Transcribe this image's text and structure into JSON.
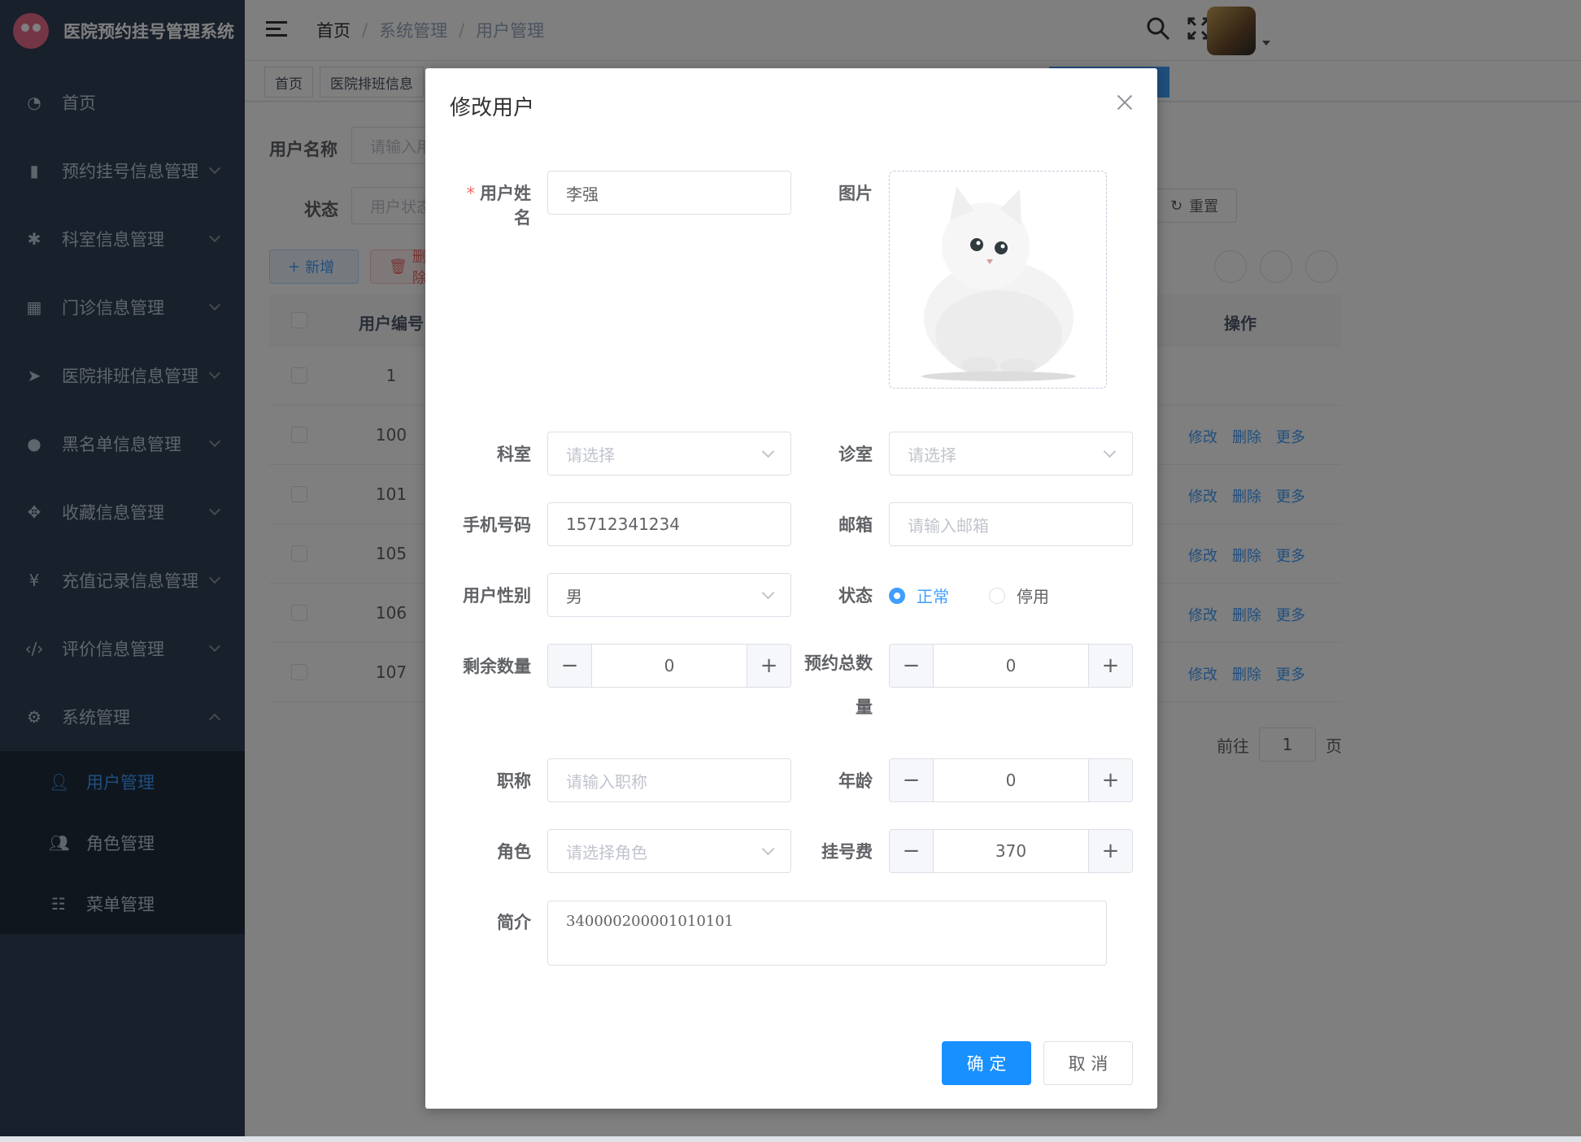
{
  "app": {
    "title": "医院预约挂号管理系统"
  },
  "sidebar": {
    "items": [
      {
        "label": "首页",
        "icon": "dashboard-icon"
      },
      {
        "label": "预约挂号信息管理",
        "icon": "bar-chart-icon"
      },
      {
        "label": "科室信息管理",
        "icon": "bug-icon"
      },
      {
        "label": "门诊信息管理",
        "icon": "table-icon"
      },
      {
        "label": "医院排班信息管理",
        "icon": "send-icon"
      },
      {
        "label": "黑名单信息管理",
        "icon": "globe-icon"
      },
      {
        "label": "收藏信息管理",
        "icon": "move-icon"
      },
      {
        "label": "充值记录信息管理",
        "icon": "yen-icon"
      },
      {
        "label": "评价信息管理",
        "icon": "code-icon"
      },
      {
        "label": "系统管理",
        "icon": "gear-icon"
      }
    ],
    "subitems": [
      {
        "label": "用户管理",
        "icon": "user-icon"
      },
      {
        "label": "角色管理",
        "icon": "peoples-icon"
      },
      {
        "label": "菜单管理",
        "icon": "tree-table-icon"
      }
    ]
  },
  "breadcrumb": {
    "home": "首页",
    "level1": "系统管理",
    "level2": "用户管理"
  },
  "tags": {
    "home": "首页",
    "schedule": "医院排班信息"
  },
  "search": {
    "username_label": "用户名称",
    "username_placeholder": "请输入用户名称",
    "status_label": "状态",
    "status_placeholder": "用户状态",
    "reset_label": "重置"
  },
  "toolbar": {
    "add_label": "新增",
    "delete_label": "删除"
  },
  "table": {
    "headers": {
      "id": "用户编号",
      "ops": "操作"
    },
    "rows": [
      {
        "id": "1"
      },
      {
        "id": "100"
      },
      {
        "id": "101"
      },
      {
        "id": "105"
      },
      {
        "id": "106"
      },
      {
        "id": "107"
      }
    ],
    "ops": {
      "edit": "修改",
      "delete": "删除",
      "more": "更多"
    }
  },
  "pager": {
    "goto": "前往",
    "page": "1",
    "page_unit": "页"
  },
  "dialog": {
    "title": "修改用户",
    "labels": {
      "name": "用户姓名",
      "image": "图片",
      "dept": "科室",
      "clinic": "诊室",
      "phone": "手机号码",
      "email": "邮箱",
      "gender": "用户性别",
      "status": "状态",
      "remaining": "剩余数量",
      "total_line1": "预约总数",
      "total_line2": "量",
      "title": "职称",
      "age": "年龄",
      "role": "角色",
      "fee": "挂号费",
      "intro": "简介"
    },
    "values": {
      "name": "李强",
      "dept_placeholder": "请选择",
      "clinic_placeholder": "请选择",
      "phone": "15712341234",
      "email_placeholder": "请输入邮箱",
      "gender": "男",
      "status_normal": "正常",
      "status_disabled": "停用",
      "remaining": "0",
      "total": "0",
      "title_placeholder": "请输入职称",
      "age": "0",
      "role_placeholder": "请选择角色",
      "fee": "370",
      "intro": "340000200001010101"
    },
    "buttons": {
      "confirm": "确 定",
      "cancel": "取 消"
    }
  },
  "colors": {
    "primary": "#409eff",
    "sidebar": "#304156",
    "confirm": "#1890ff"
  }
}
